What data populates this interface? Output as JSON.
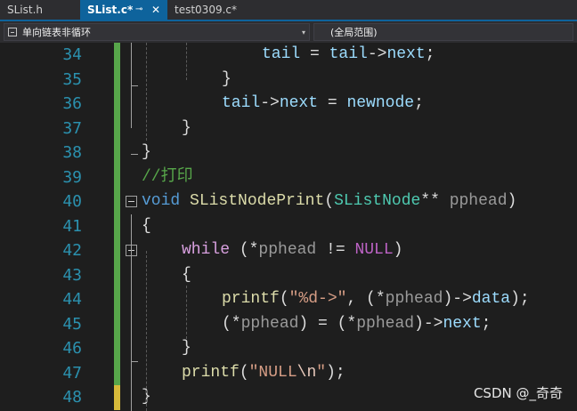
{
  "tabs": [
    {
      "label": "SList.h"
    },
    {
      "label": "SList.c*",
      "pin": "⊸",
      "close": "✕"
    },
    {
      "label": "test0309.c*"
    }
  ],
  "navbar": {
    "project_dropdown": "单向链表非循环",
    "scope_dropdown": "(全局范围)",
    "chevron": "▾"
  },
  "lines": [
    {
      "num": "34",
      "tokens": [
        {
          "t": "tail",
          "c": "var"
        },
        {
          "t": " = ",
          "c": "pl"
        },
        {
          "t": "tail",
          "c": "var"
        },
        {
          "t": "->",
          "c": "pl"
        },
        {
          "t": "next",
          "c": "var"
        },
        {
          "t": ";",
          "c": "pl"
        }
      ]
    },
    {
      "num": "35",
      "tokens": [
        {
          "t": "}",
          "c": "pl"
        }
      ]
    },
    {
      "num": "36",
      "tokens": [
        {
          "t": "tail",
          "c": "var"
        },
        {
          "t": "->",
          "c": "pl"
        },
        {
          "t": "next",
          "c": "var"
        },
        {
          "t": " = ",
          "c": "pl"
        },
        {
          "t": "newnode",
          "c": "var"
        },
        {
          "t": ";",
          "c": "pl"
        }
      ]
    },
    {
      "num": "37",
      "tokens": [
        {
          "t": "}",
          "c": "pl"
        }
      ]
    },
    {
      "num": "38",
      "tokens": [
        {
          "t": "}",
          "c": "pl"
        }
      ]
    },
    {
      "num": "39",
      "tokens": [
        {
          "t": "//打印",
          "c": "cm"
        }
      ]
    },
    {
      "num": "40",
      "tokens": [
        {
          "t": "void",
          "c": "kw"
        },
        {
          "t": " ",
          "c": "pl"
        },
        {
          "t": "SListNodePrint",
          "c": "fn"
        },
        {
          "t": "(",
          "c": "pl"
        },
        {
          "t": "SListNode",
          "c": "type"
        },
        {
          "t": "** ",
          "c": "pl"
        },
        {
          "t": "pphead",
          "c": "par"
        },
        {
          "t": ")",
          "c": "pl"
        }
      ]
    },
    {
      "num": "41",
      "tokens": [
        {
          "t": "{",
          "c": "pl"
        }
      ]
    },
    {
      "num": "42",
      "tokens": [
        {
          "t": "while",
          "c": "ctl"
        },
        {
          "t": " (*",
          "c": "pl"
        },
        {
          "t": "pphead",
          "c": "par"
        },
        {
          "t": " != ",
          "c": "pl"
        },
        {
          "t": "NULL",
          "c": "mac"
        },
        {
          "t": ")",
          "c": "pl"
        }
      ]
    },
    {
      "num": "43",
      "tokens": [
        {
          "t": "{",
          "c": "pl"
        }
      ]
    },
    {
      "num": "44",
      "tokens": [
        {
          "t": "printf",
          "c": "fn"
        },
        {
          "t": "(",
          "c": "pl"
        },
        {
          "t": "\"%d->\"",
          "c": "str"
        },
        {
          "t": ", (*",
          "c": "pl"
        },
        {
          "t": "pphead",
          "c": "par"
        },
        {
          "t": ")->",
          "c": "pl"
        },
        {
          "t": "data",
          "c": "var"
        },
        {
          "t": ");",
          "c": "pl"
        }
      ]
    },
    {
      "num": "45",
      "tokens": [
        {
          "t": "(*",
          "c": "pl"
        },
        {
          "t": "pphead",
          "c": "par"
        },
        {
          "t": ") = (*",
          "c": "pl"
        },
        {
          "t": "pphead",
          "c": "par"
        },
        {
          "t": ")->",
          "c": "pl"
        },
        {
          "t": "next",
          "c": "var"
        },
        {
          "t": ";",
          "c": "pl"
        }
      ]
    },
    {
      "num": "46",
      "tokens": [
        {
          "t": "}",
          "c": "pl"
        }
      ]
    },
    {
      "num": "47",
      "tokens": [
        {
          "t": "printf",
          "c": "fn"
        },
        {
          "t": "(",
          "c": "pl"
        },
        {
          "t": "\"NULL",
          "c": "str"
        },
        {
          "t": "\\n",
          "c": "esc"
        },
        {
          "t": "\"",
          "c": "str"
        },
        {
          "t": ");",
          "c": "pl"
        }
      ]
    },
    {
      "num": "48",
      "tokens": [
        {
          "t": "}",
          "c": "pl"
        }
      ]
    }
  ],
  "watermark": "CSDN @_奇奇",
  "colors": {
    "accent": "#0e639c",
    "line_number": "#2b91af",
    "change_saved": "#57a64a",
    "change_unsaved": "#d7ba3a"
  }
}
